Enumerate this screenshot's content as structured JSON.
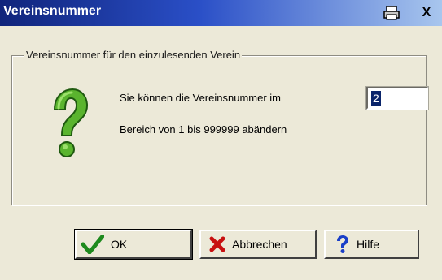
{
  "window": {
    "title": "Vereinsnummer",
    "print_icon": "printer-icon",
    "close_label": "X"
  },
  "group": {
    "legend": "Vereinsnummer für den einzulesenden Verein"
  },
  "message": {
    "line1": "Sie können die Vereinsnummer im",
    "line2": "Bereich von 1 bis 999999 abändern",
    "icon": "question-icon"
  },
  "input": {
    "value": "2"
  },
  "buttons": {
    "ok": {
      "label": "OK",
      "icon": "checkmark-icon"
    },
    "cancel": {
      "label": "Abbrechen",
      "icon": "x-icon"
    },
    "help": {
      "label": "Hilfe",
      "icon": "question-icon"
    }
  },
  "colors": {
    "titlebar_start": "#10247b",
    "titlebar_end": "#a8c6ee",
    "dialog_bg": "#ece9d8",
    "selection": "#0a246a"
  }
}
